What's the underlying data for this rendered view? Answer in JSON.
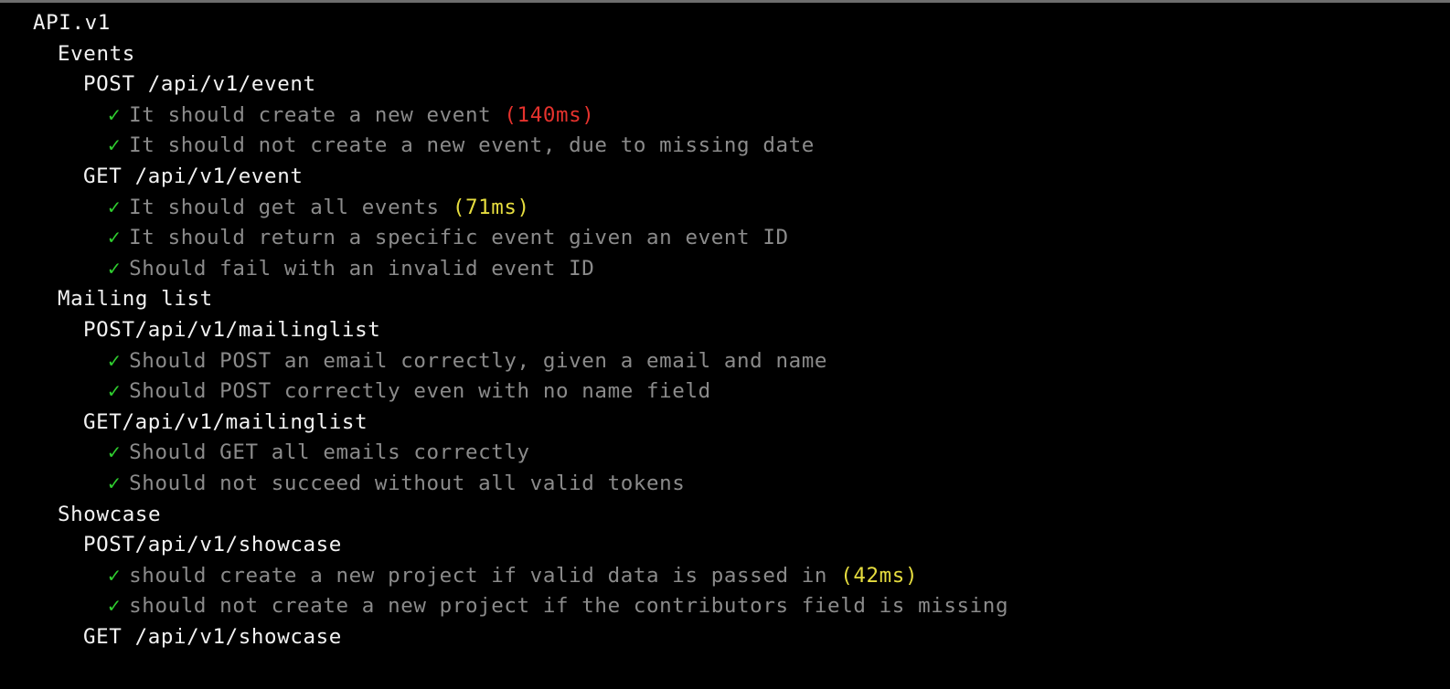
{
  "colors": {
    "background": "#000000",
    "suite_text": "#f2f2f2",
    "pass_check": "#2fce2f",
    "test_text": "#8b8b8b",
    "duration_slow": "#e5322d",
    "duration_medium": "#e6dd3f"
  },
  "check_glyph": "✓",
  "root_suite": "API.v1",
  "suites": [
    {
      "title": "Events",
      "groups": [
        {
          "title": "POST /api/v1/event",
          "tests": [
            {
              "title": "It should create a new event",
              "duration": "(140ms)",
              "speed": "slow"
            },
            {
              "title": "It should not create a new event, due to missing date",
              "duration": "",
              "speed": ""
            }
          ]
        },
        {
          "title": "GET /api/v1/event",
          "tests": [
            {
              "title": "It should get all events",
              "duration": "(71ms)",
              "speed": "medium"
            },
            {
              "title": "It should return a specific event given an event ID",
              "duration": "",
              "speed": ""
            },
            {
              "title": "Should fail with an invalid event ID",
              "duration": "",
              "speed": ""
            }
          ]
        }
      ]
    },
    {
      "title": "Mailing list",
      "groups": [
        {
          "title": "POST/api/v1/mailinglist",
          "tests": [
            {
              "title": "Should POST an email correctly, given a email and name",
              "duration": "",
              "speed": ""
            },
            {
              "title": "Should POST correctly even with no name field",
              "duration": "",
              "speed": ""
            }
          ]
        },
        {
          "title": "GET/api/v1/mailinglist",
          "tests": [
            {
              "title": "Should GET all emails correctly",
              "duration": "",
              "speed": ""
            },
            {
              "title": "Should not succeed without all valid tokens",
              "duration": "",
              "speed": ""
            }
          ]
        }
      ]
    },
    {
      "title": "Showcase",
      "groups": [
        {
          "title": "POST/api/v1/showcase",
          "tests": [
            {
              "title": "should create a new project if valid data is passed in",
              "duration": "(42ms)",
              "speed": "medium"
            },
            {
              "title": "should not create a new project if the contributors field is missing",
              "duration": "",
              "speed": ""
            }
          ]
        },
        {
          "title": "GET /api/v1/showcase",
          "tests": []
        }
      ]
    }
  ]
}
